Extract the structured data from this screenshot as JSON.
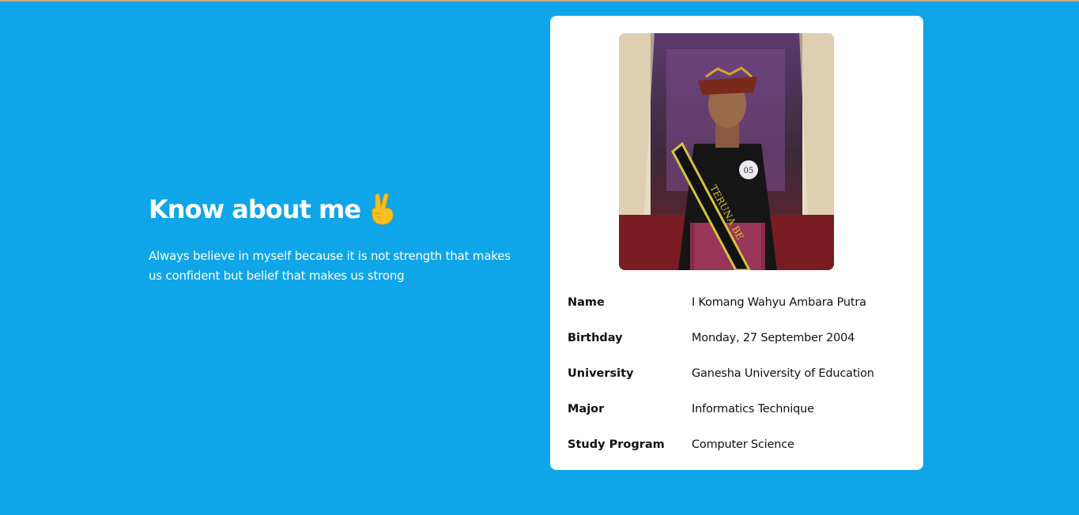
{
  "hero": {
    "title": "Know about me",
    "emoji_icon": "victory-hand-icon",
    "quote": "Always believe in myself because it is not strength that makes us confident but belief that makes us strong"
  },
  "profile": {
    "photo_number_badge": "05",
    "photo_sash_text": "TERUNA BE",
    "rows": [
      {
        "label": "Name",
        "value": "I Komang Wahyu Ambara Putra"
      },
      {
        "label": "Birthday",
        "value": "Monday, 27 September 2004"
      },
      {
        "label": "University",
        "value": "Ganesha University of Education"
      },
      {
        "label": "Major",
        "value": "Informatics Technique"
      },
      {
        "label": "Study Program",
        "value": "Computer Science"
      }
    ]
  },
  "colors": {
    "background": "#0ea5e9",
    "card": "#ffffff",
    "emoji": "#fbbf24"
  }
}
